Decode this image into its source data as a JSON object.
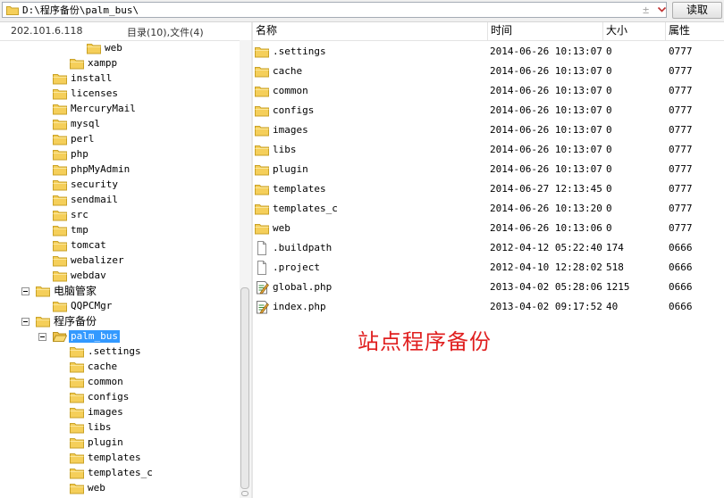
{
  "address": {
    "path": "D:\\程序备份\\palm_bus\\",
    "read_label": "读取"
  },
  "left_header": {
    "ip": "202.101.6.118",
    "summary": "目录(10),文件(4)"
  },
  "tree": [
    {
      "label": "web",
      "depth": 5,
      "expander": false,
      "selected": false
    },
    {
      "label": "xampp",
      "depth": 4,
      "expander": false,
      "selected": false
    },
    {
      "label": "install",
      "depth": 3,
      "expander": false,
      "selected": false
    },
    {
      "label": "licenses",
      "depth": 3,
      "expander": false,
      "selected": false
    },
    {
      "label": "MercuryMail",
      "depth": 3,
      "expander": false,
      "selected": false
    },
    {
      "label": "mysql",
      "depth": 3,
      "expander": false,
      "selected": false
    },
    {
      "label": "perl",
      "depth": 3,
      "expander": false,
      "selected": false
    },
    {
      "label": "php",
      "depth": 3,
      "expander": false,
      "selected": false
    },
    {
      "label": "phpMyAdmin",
      "depth": 3,
      "expander": false,
      "selected": false
    },
    {
      "label": "security",
      "depth": 3,
      "expander": false,
      "selected": false
    },
    {
      "label": "sendmail",
      "depth": 3,
      "expander": false,
      "selected": false
    },
    {
      "label": "src",
      "depth": 3,
      "expander": false,
      "selected": false
    },
    {
      "label": "tmp",
      "depth": 3,
      "expander": false,
      "selected": false
    },
    {
      "label": "tomcat",
      "depth": 3,
      "expander": false,
      "selected": false
    },
    {
      "label": "webalizer",
      "depth": 3,
      "expander": false,
      "selected": false
    },
    {
      "label": "webdav",
      "depth": 3,
      "expander": false,
      "selected": false
    },
    {
      "label": "电脑管家",
      "depth": 2,
      "expander": true,
      "selected": false,
      "cn": true
    },
    {
      "label": "QQPCMgr",
      "depth": 3,
      "expander": false,
      "selected": false
    },
    {
      "label": "程序备份",
      "depth": 2,
      "expander": true,
      "selected": false,
      "cn": true
    },
    {
      "label": "palm_bus",
      "depth": 3,
      "expander": true,
      "selected": true,
      "open": true
    },
    {
      "label": ".settings",
      "depth": 4,
      "expander": false,
      "selected": false
    },
    {
      "label": "cache",
      "depth": 4,
      "expander": false,
      "selected": false
    },
    {
      "label": "common",
      "depth": 4,
      "expander": false,
      "selected": false
    },
    {
      "label": "configs",
      "depth": 4,
      "expander": false,
      "selected": false
    },
    {
      "label": "images",
      "depth": 4,
      "expander": false,
      "selected": false
    },
    {
      "label": "libs",
      "depth": 4,
      "expander": false,
      "selected": false
    },
    {
      "label": "plugin",
      "depth": 4,
      "expander": false,
      "selected": false
    },
    {
      "label": "templates",
      "depth": 4,
      "expander": false,
      "selected": false
    },
    {
      "label": "templates_c",
      "depth": 4,
      "expander": false,
      "selected": false
    },
    {
      "label": "web",
      "depth": 4,
      "expander": false,
      "selected": false
    }
  ],
  "columns": [
    "名称",
    "时间",
    "大小",
    "属性"
  ],
  "files": [
    {
      "name": ".settings",
      "time": "2014-06-26 10:13:07",
      "size": "0",
      "attr": "0777",
      "icon": "folder-icon"
    },
    {
      "name": "cache",
      "time": "2014-06-26 10:13:07",
      "size": "0",
      "attr": "0777",
      "icon": "folder-icon"
    },
    {
      "name": "common",
      "time": "2014-06-26 10:13:07",
      "size": "0",
      "attr": "0777",
      "icon": "folder-icon"
    },
    {
      "name": "configs",
      "time": "2014-06-26 10:13:07",
      "size": "0",
      "attr": "0777",
      "icon": "folder-icon"
    },
    {
      "name": "images",
      "time": "2014-06-26 10:13:07",
      "size": "0",
      "attr": "0777",
      "icon": "folder-icon"
    },
    {
      "name": "libs",
      "time": "2014-06-26 10:13:07",
      "size": "0",
      "attr": "0777",
      "icon": "folder-icon"
    },
    {
      "name": "plugin",
      "time": "2014-06-26 10:13:07",
      "size": "0",
      "attr": "0777",
      "icon": "folder-icon"
    },
    {
      "name": "templates",
      "time": "2014-06-27 12:13:45",
      "size": "0",
      "attr": "0777",
      "icon": "folder-icon"
    },
    {
      "name": "templates_c",
      "time": "2014-06-26 10:13:20",
      "size": "0",
      "attr": "0777",
      "icon": "folder-icon"
    },
    {
      "name": "web",
      "time": "2014-06-26 10:13:06",
      "size": "0",
      "attr": "0777",
      "icon": "folder-icon"
    },
    {
      "name": ".buildpath",
      "time": "2012-04-12 05:22:40",
      "size": "174",
      "attr": "0666",
      "icon": "file-icon"
    },
    {
      "name": ".project",
      "time": "2012-04-10 12:28:02",
      "size": "518",
      "attr": "0666",
      "icon": "file-icon"
    },
    {
      "name": "global.php",
      "time": "2013-04-02 05:28:06",
      "size": "1215",
      "attr": "0666",
      "icon": "php-file-icon"
    },
    {
      "name": "index.php",
      "time": "2013-04-02 09:17:52",
      "size": "40",
      "attr": "0666",
      "icon": "php-file-icon"
    }
  ],
  "annotation": "站点程序备份",
  "colors": {
    "selection": "#3399ff",
    "folder": "#f5cf5a",
    "annotation": "#e02020"
  }
}
